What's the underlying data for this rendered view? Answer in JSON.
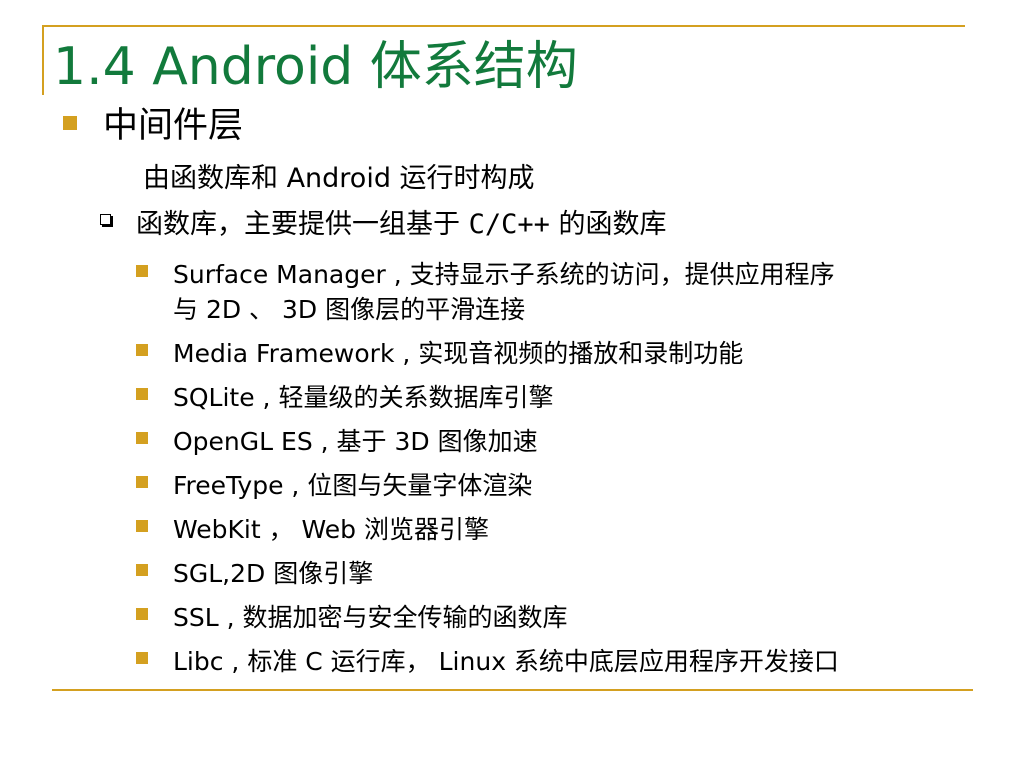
{
  "slide": {
    "title": "1.4  Android 体系结构",
    "heading": "中间件层",
    "subheading": "由函数库和 Android 运行时构成",
    "section": {
      "prefix": "函数库，主要提供一组基于 ",
      "code": "C/C++",
      "suffix": " 的函数库"
    },
    "items": [
      {
        "pre": "Surface Manager , 支持显示子系统的访问，提供应用程序",
        "cont": "与 2D 、 3D 图像层的平滑连接"
      },
      {
        "pre": "Media Framework , 实现音视频的播放和录制功能"
      },
      {
        "pre": "SQLite , 轻量级的关系数据库引擎"
      },
      {
        "pre": "OpenGL ES , 基于 3D 图像加速"
      },
      {
        "pre": "FreeType , 位图与矢量字体渲染"
      },
      {
        "pre": "WebKit ， Web 浏览器引擎"
      },
      {
        "pre": "SGL,2D 图像引擎"
      },
      {
        "pre": "SSL , 数据加密与安全传输的函数库"
      },
      {
        "pre": "Libc , 标准 C 运行库， Linux 系统中底层应用程序开发接口"
      }
    ]
  },
  "colors": {
    "title": "#127a3c",
    "accent": "#d4a020",
    "text": "#000000"
  },
  "icons": {
    "level1": "filled-square-bullet",
    "level2": "hollow-square-bullet",
    "level3": "filled-square-bullet"
  }
}
